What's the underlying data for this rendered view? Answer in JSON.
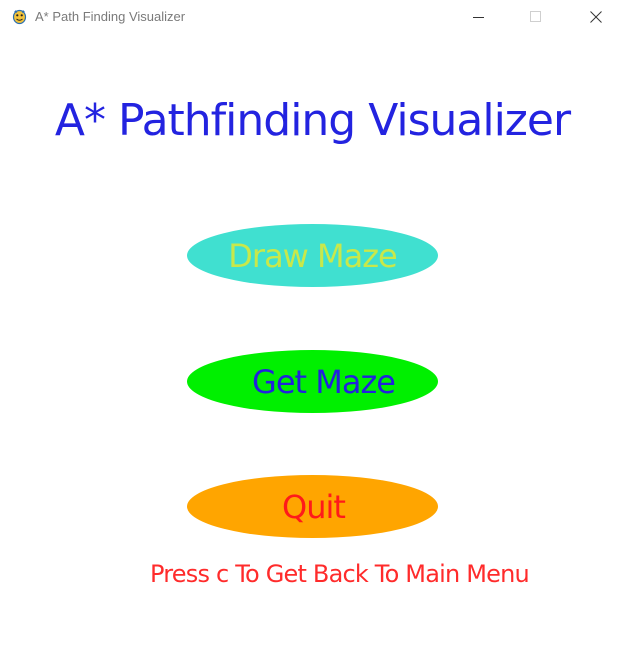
{
  "window": {
    "title": "A* Path Finding Visualizer",
    "icon": "pygame-snake-icon",
    "controls": [
      "minimize-icon",
      "maximize-icon",
      "close-icon"
    ]
  },
  "main": {
    "heading": "A* Pathfinding Visualizer",
    "buttons": [
      {
        "label": "Draw Maze",
        "bg": "#40e0d0",
        "fg": "#c8e84a"
      },
      {
        "label": "Get Maze",
        "bg": "#00f000",
        "fg": "#2222dd"
      },
      {
        "label": "Quit",
        "bg": "#ffa500",
        "fg": "#ff1a1a"
      }
    ],
    "hint": "Press c To Get Back To Main Menu"
  },
  "colors": {
    "heading": "#2323e0",
    "hint": "#ff2b2b",
    "background": "#ffffff"
  }
}
